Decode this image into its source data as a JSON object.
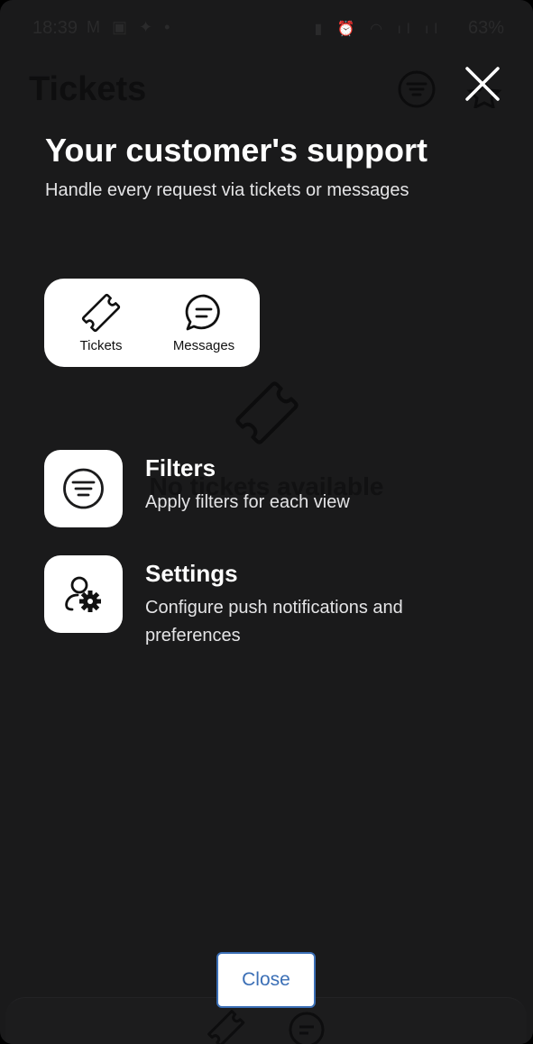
{
  "statusbar": {
    "time": "18:39",
    "left_icons": "M ▣ ✦ •",
    "right_icons": "▮ ⏰ ◠ ıl ıl",
    "battery": "63%"
  },
  "app": {
    "title": "Tickets",
    "empty_state": "No tickets available"
  },
  "overlay": {
    "headline": "Your customer's support",
    "subline": "Handle every request via tickets or messages",
    "tabs": [
      {
        "label": "Tickets",
        "icon": "ticket-icon"
      },
      {
        "label": "Messages",
        "icon": "message-icon"
      }
    ],
    "features": [
      {
        "title": "Filters",
        "description": "Apply filters for each view",
        "icon": "filter-icon"
      },
      {
        "title": "Settings",
        "description": "Configure push notifications and preferences",
        "icon": "user-settings-icon"
      }
    ],
    "close_label": "Close"
  },
  "colors": {
    "background": "#1a1a1b",
    "card": "#ffffff",
    "accent": "#3b6fb6",
    "text": "#ffffff"
  }
}
